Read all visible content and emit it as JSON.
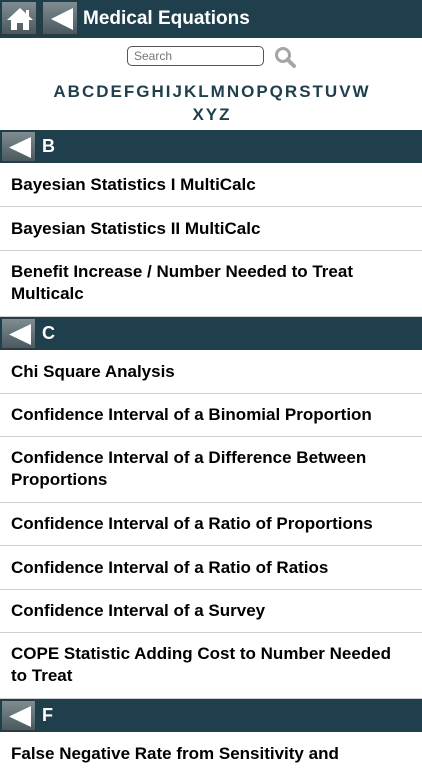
{
  "header": {
    "title": "Medical Equations",
    "home_icon": "home-icon",
    "back_icon": "back-arrow-icon"
  },
  "search": {
    "placeholder": "Search",
    "value": "",
    "icon": "search-icon"
  },
  "alphabet": {
    "row1": [
      "A",
      "B",
      "C",
      "D",
      "E",
      "F",
      "G",
      "H",
      "I",
      "J",
      "K",
      "L",
      "M",
      "N",
      "O",
      "P",
      "Q",
      "R",
      "S",
      "T",
      "U",
      "V",
      "W"
    ],
    "row2": [
      "X",
      "Y",
      "Z"
    ]
  },
  "sections": [
    {
      "letter": "B",
      "items": [
        "Bayesian Statistics I MultiCalc",
        "Bayesian Statistics II MultiCalc",
        "Benefit Increase / Number Needed to Treat Multicalc"
      ]
    },
    {
      "letter": "C",
      "items": [
        "Chi Square Analysis",
        "Confidence Interval of a Binomial Proportion",
        "Confidence Interval of a Difference Between Proportions",
        "Confidence Interval of a Ratio of Proportions",
        "Confidence Interval of a Ratio of Ratios",
        "Confidence Interval of a Survey",
        "COPE Statistic Adding Cost to Number Needed to Treat"
      ]
    },
    {
      "letter": "F",
      "items": [
        "False Negative Rate from Sensitivity and"
      ]
    }
  ],
  "colors": {
    "header_bg": "#1e3f4b",
    "alpha_text": "#1e3f4b"
  }
}
